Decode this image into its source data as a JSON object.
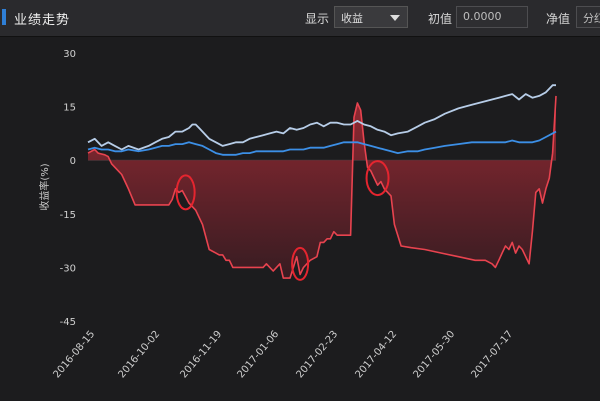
{
  "header": {
    "title": "业绩走势",
    "display_label": "显示",
    "display_select": "收益",
    "initial_label": "初值",
    "initial_value": "0.0000",
    "nav_label": "净值",
    "nav_select": "分红"
  },
  "chart_data": {
    "type": "line",
    "ylabel": "收益率(%)",
    "ylim": [
      -45,
      30
    ],
    "yticks": [
      "30",
      "15",
      "0",
      "-15",
      "-30",
      "-45"
    ],
    "xticks": [
      "2016-08-15",
      "2016-10-02",
      "2016-11-19",
      "2017-01-06",
      "2017-02-23",
      "2017-04-12",
      "2017-05-30",
      "2017-07-17"
    ],
    "series": [
      {
        "color": "#e8434f",
        "fill": true,
        "values": [
          [
            0,
            2
          ],
          [
            0.02,
            3
          ],
          [
            0.03,
            2
          ],
          [
            0.05,
            1.5
          ],
          [
            0.06,
            1
          ],
          [
            0.07,
            -1
          ],
          [
            0.08,
            -2
          ],
          [
            0.1,
            -4
          ],
          [
            0.12,
            -8
          ],
          [
            0.14,
            -12.5
          ],
          [
            0.2,
            -12.5
          ],
          [
            0.22,
            -12.5
          ],
          [
            0.24,
            -12.5
          ],
          [
            0.25,
            -11
          ],
          [
            0.26,
            -8
          ],
          [
            0.27,
            -9
          ],
          [
            0.28,
            -8.5
          ],
          [
            0.3,
            -12
          ],
          [
            0.32,
            -14
          ],
          [
            0.34,
            -18
          ],
          [
            0.36,
            -25
          ],
          [
            0.38,
            -26
          ],
          [
            0.39,
            -26.5
          ],
          [
            0.4,
            -26.5
          ],
          [
            0.41,
            -28
          ],
          [
            0.42,
            -28
          ],
          [
            0.43,
            -30
          ],
          [
            0.48,
            -30
          ],
          [
            0.5,
            -30
          ],
          [
            0.52,
            -30
          ],
          [
            0.53,
            -29
          ],
          [
            0.54,
            -30
          ],
          [
            0.55,
            -31
          ],
          [
            0.56,
            -30
          ],
          [
            0.57,
            -29
          ],
          [
            0.58,
            -33
          ],
          [
            0.6,
            -33
          ],
          [
            0.61,
            -30
          ],
          [
            0.62,
            -27
          ],
          [
            0.63,
            -32
          ],
          [
            0.64,
            -30
          ],
          [
            0.66,
            -28
          ],
          [
            0.68,
            -27
          ],
          [
            0.69,
            -23
          ],
          [
            0.7,
            -23
          ],
          [
            0.71,
            -22
          ],
          [
            0.72,
            -22
          ],
          [
            0.73,
            -20
          ],
          [
            0.74,
            -21
          ],
          [
            0.76,
            -21
          ],
          [
            0.78,
            -21
          ],
          [
            0.79,
            12
          ],
          [
            0.8,
            16
          ],
          [
            0.81,
            14
          ],
          [
            0.82,
            5
          ],
          [
            0.83,
            -2
          ],
          [
            0.84,
            -3
          ],
          [
            0.85,
            -5
          ],
          [
            0.86,
            -7
          ],
          [
            0.87,
            -6
          ],
          [
            0.88,
            -8
          ],
          [
            0.9,
            -10
          ],
          [
            0.91,
            -18
          ],
          [
            0.93,
            -24
          ],
          [
            0.96,
            -24.5
          ],
          [
            1.0,
            -25
          ],
          [
            1.05,
            -26
          ],
          [
            1.1,
            -27
          ],
          [
            1.15,
            -28
          ],
          [
            1.18,
            -28
          ],
          [
            1.2,
            -29
          ],
          [
            1.21,
            -30
          ],
          [
            1.22,
            -28
          ],
          [
            1.23,
            -26
          ],
          [
            1.24,
            -24
          ],
          [
            1.25,
            -25
          ],
          [
            1.26,
            -23
          ],
          [
            1.27,
            -26
          ],
          [
            1.28,
            -24
          ],
          [
            1.29,
            -25
          ],
          [
            1.3,
            -27
          ],
          [
            1.31,
            -29
          ],
          [
            1.32,
            -20
          ],
          [
            1.33,
            -9
          ],
          [
            1.34,
            -8
          ],
          [
            1.35,
            -12
          ],
          [
            1.36,
            -8
          ],
          [
            1.37,
            -5
          ],
          [
            1.38,
            2
          ],
          [
            1.39,
            18
          ]
        ]
      },
      {
        "color": "#b7cde8",
        "values": [
          [
            0,
            5
          ],
          [
            0.02,
            6
          ],
          [
            0.04,
            4
          ],
          [
            0.06,
            5
          ],
          [
            0.08,
            4
          ],
          [
            0.1,
            3
          ],
          [
            0.12,
            4
          ],
          [
            0.15,
            3
          ],
          [
            0.18,
            4
          ],
          [
            0.2,
            5
          ],
          [
            0.22,
            6
          ],
          [
            0.24,
            6.5
          ],
          [
            0.26,
            8
          ],
          [
            0.28,
            8
          ],
          [
            0.3,
            9
          ],
          [
            0.31,
            10
          ],
          [
            0.32,
            10
          ],
          [
            0.33,
            9
          ],
          [
            0.34,
            8
          ],
          [
            0.36,
            6
          ],
          [
            0.38,
            5
          ],
          [
            0.4,
            4
          ],
          [
            0.42,
            4.5
          ],
          [
            0.44,
            5
          ],
          [
            0.46,
            5
          ],
          [
            0.48,
            6
          ],
          [
            0.5,
            6.5
          ],
          [
            0.52,
            7
          ],
          [
            0.54,
            7.5
          ],
          [
            0.56,
            8
          ],
          [
            0.58,
            7.5
          ],
          [
            0.6,
            9
          ],
          [
            0.62,
            8.5
          ],
          [
            0.64,
            9
          ],
          [
            0.66,
            10
          ],
          [
            0.68,
            10.5
          ],
          [
            0.69,
            10
          ],
          [
            0.7,
            9.5
          ],
          [
            0.72,
            10.5
          ],
          [
            0.74,
            10.5
          ],
          [
            0.76,
            10
          ],
          [
            0.78,
            10
          ],
          [
            0.8,
            11
          ],
          [
            0.82,
            10
          ],
          [
            0.84,
            9.5
          ],
          [
            0.86,
            8.5
          ],
          [
            0.88,
            8
          ],
          [
            0.9,
            7
          ],
          [
            0.92,
            7.5
          ],
          [
            0.95,
            8
          ],
          [
            0.98,
            9.5
          ],
          [
            1.0,
            10.5
          ],
          [
            1.03,
            11.5
          ],
          [
            1.06,
            13
          ],
          [
            1.1,
            14.5
          ],
          [
            1.14,
            15.5
          ],
          [
            1.18,
            16.5
          ],
          [
            1.2,
            17
          ],
          [
            1.22,
            17.5
          ],
          [
            1.24,
            18
          ],
          [
            1.26,
            18.5
          ],
          [
            1.28,
            17
          ],
          [
            1.3,
            18.5
          ],
          [
            1.32,
            17.5
          ],
          [
            1.34,
            18
          ],
          [
            1.36,
            19
          ],
          [
            1.38,
            21
          ],
          [
            1.39,
            21
          ]
        ]
      },
      {
        "color": "#3c8fe6",
        "values": [
          [
            0,
            3
          ],
          [
            0.02,
            3.5
          ],
          [
            0.04,
            3
          ],
          [
            0.06,
            3
          ],
          [
            0.08,
            2.5
          ],
          [
            0.1,
            2.5
          ],
          [
            0.12,
            3
          ],
          [
            0.15,
            2.5
          ],
          [
            0.18,
            3
          ],
          [
            0.2,
            3.5
          ],
          [
            0.22,
            4
          ],
          [
            0.24,
            4
          ],
          [
            0.26,
            4.5
          ],
          [
            0.28,
            4.5
          ],
          [
            0.3,
            5
          ],
          [
            0.32,
            4.5
          ],
          [
            0.34,
            4
          ],
          [
            0.36,
            3
          ],
          [
            0.38,
            2
          ],
          [
            0.4,
            1.5
          ],
          [
            0.42,
            1.5
          ],
          [
            0.44,
            1.5
          ],
          [
            0.46,
            2
          ],
          [
            0.48,
            2
          ],
          [
            0.5,
            2.5
          ],
          [
            0.52,
            2.5
          ],
          [
            0.54,
            2.5
          ],
          [
            0.56,
            2.5
          ],
          [
            0.58,
            2.5
          ],
          [
            0.6,
            3
          ],
          [
            0.62,
            3
          ],
          [
            0.64,
            3
          ],
          [
            0.66,
            3.5
          ],
          [
            0.68,
            3.5
          ],
          [
            0.7,
            3.5
          ],
          [
            0.72,
            4
          ],
          [
            0.74,
            4.5
          ],
          [
            0.76,
            5
          ],
          [
            0.78,
            5
          ],
          [
            0.8,
            5
          ],
          [
            0.82,
            4.5
          ],
          [
            0.84,
            4
          ],
          [
            0.86,
            3.5
          ],
          [
            0.88,
            3
          ],
          [
            0.9,
            2.5
          ],
          [
            0.92,
            2
          ],
          [
            0.95,
            2.5
          ],
          [
            0.98,
            2.5
          ],
          [
            1.0,
            3
          ],
          [
            1.03,
            3.5
          ],
          [
            1.06,
            4
          ],
          [
            1.1,
            4.5
          ],
          [
            1.14,
            5
          ],
          [
            1.18,
            5
          ],
          [
            1.2,
            5
          ],
          [
            1.22,
            5
          ],
          [
            1.24,
            5
          ],
          [
            1.26,
            5.5
          ],
          [
            1.28,
            5
          ],
          [
            1.3,
            5
          ],
          [
            1.32,
            5
          ],
          [
            1.34,
            5.5
          ],
          [
            1.36,
            6.5
          ],
          [
            1.38,
            7.5
          ],
          [
            1.39,
            8
          ]
        ]
      }
    ],
    "annotations": [
      {
        "type": "ellipse",
        "x": 0.29,
        "y": -9
      },
      {
        "type": "ellipse",
        "x": 0.63,
        "y": -29
      },
      {
        "type": "ellipse",
        "x": 0.86,
        "y": -5
      }
    ]
  }
}
